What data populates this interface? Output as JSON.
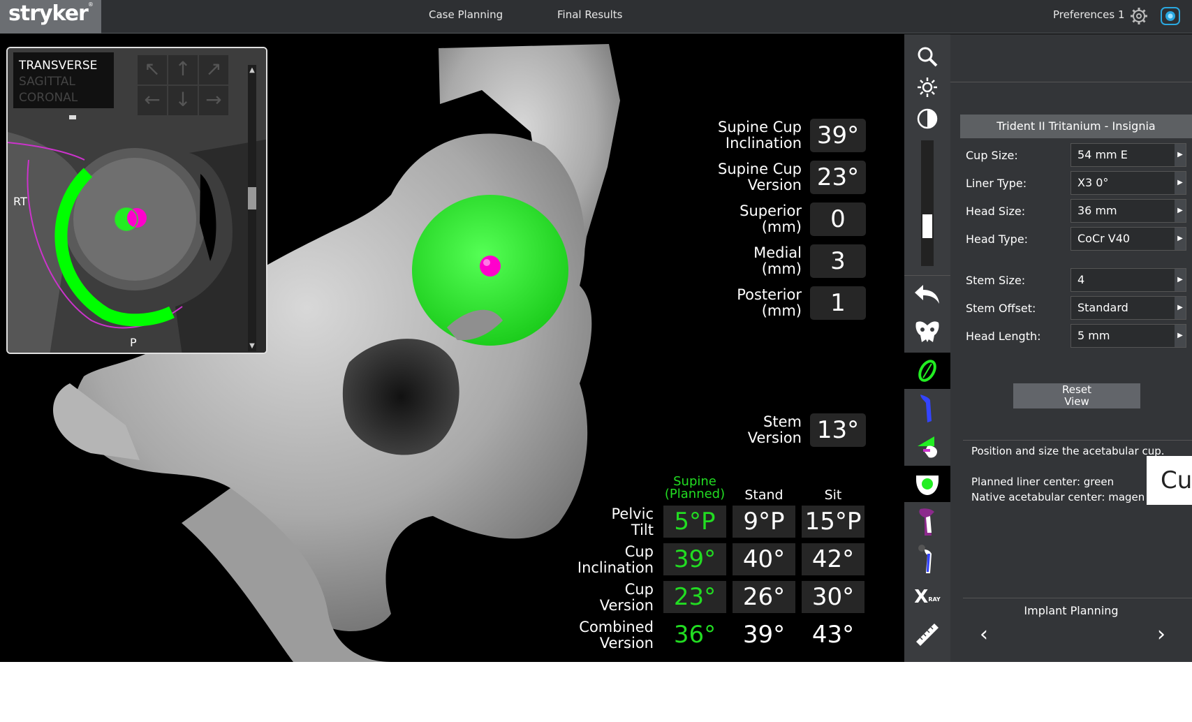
{
  "header": {
    "logo": "stryker",
    "logo_mark": "®",
    "nav": [
      "Case Planning",
      "Final Results"
    ],
    "preferences": "Preferences 1"
  },
  "inset": {
    "views": [
      "TRANSVERSE",
      "SAGITTAL",
      "CORONAL"
    ],
    "active_view": "TRANSVERSE",
    "label_rt": "RT",
    "label_p": "P"
  },
  "measurements": [
    {
      "label": "Supine Cup\nInclination",
      "value": "39°"
    },
    {
      "label": "Supine Cup\nVersion",
      "value": "23°"
    },
    {
      "label": "Superior\n(mm)",
      "value": "0"
    },
    {
      "label": "Medial\n(mm)",
      "value": "3"
    },
    {
      "label": "Posterior\n(mm)",
      "value": "1"
    },
    {
      "label": "Stem\nVersion",
      "value": "13°"
    }
  ],
  "position_table": {
    "columns": [
      "Supine\n(Planned)",
      "Stand",
      "Sit"
    ],
    "rows": [
      {
        "label": "Pelvic\nTilt",
        "values": [
          "5°P",
          "9°P",
          "15°P"
        ]
      },
      {
        "label": "Cup\nInclination",
        "values": [
          "39°",
          "40°",
          "42°"
        ]
      },
      {
        "label": "Cup\nVersion",
        "values": [
          "23°",
          "26°",
          "30°"
        ]
      },
      {
        "label": "Combined\nVersion",
        "values": [
          "36°",
          "39°",
          "43°"
        ]
      }
    ]
  },
  "panel": {
    "implant": "Trident II Tritanium - Insignia",
    "fields": [
      {
        "label": "Cup Size:",
        "value": "54 mm E"
      },
      {
        "label": "Liner Type:",
        "value": "X3 0°"
      },
      {
        "label": "Head Size:",
        "value": "36 mm"
      },
      {
        "label": "Head Type:",
        "value": "CoCr V40"
      },
      {
        "label": "Stem Size:",
        "value": "4"
      },
      {
        "label": "Stem Offset:",
        "value": "Standard"
      },
      {
        "label": "Head Length:",
        "value": "5 mm"
      }
    ],
    "reset": "Reset\nView",
    "instruction": "Position and size the acetabular cup.",
    "legend_line1": "Planned liner center: green",
    "legend_line2": "Native acetabular center: magen",
    "overlay_fragment": "Cu",
    "step": "Implant Planning",
    "prev": "‹",
    "next": "›"
  },
  "colors": {
    "accent_green": "#22dd22",
    "magenta": "#ff00cc",
    "record_blue": "#2aa8e0"
  },
  "icons": [
    "search-icon",
    "brightness-icon",
    "contrast-icon",
    "undo-icon",
    "pelvis-icon",
    "cup-icon",
    "stem-icon",
    "femur-cut-icon",
    "cup-ream-icon",
    "femur-icon",
    "stem-leg-icon",
    "xray-icon",
    "ruler-icon"
  ],
  "xray_text": "X",
  "xray_sub": "RAY"
}
